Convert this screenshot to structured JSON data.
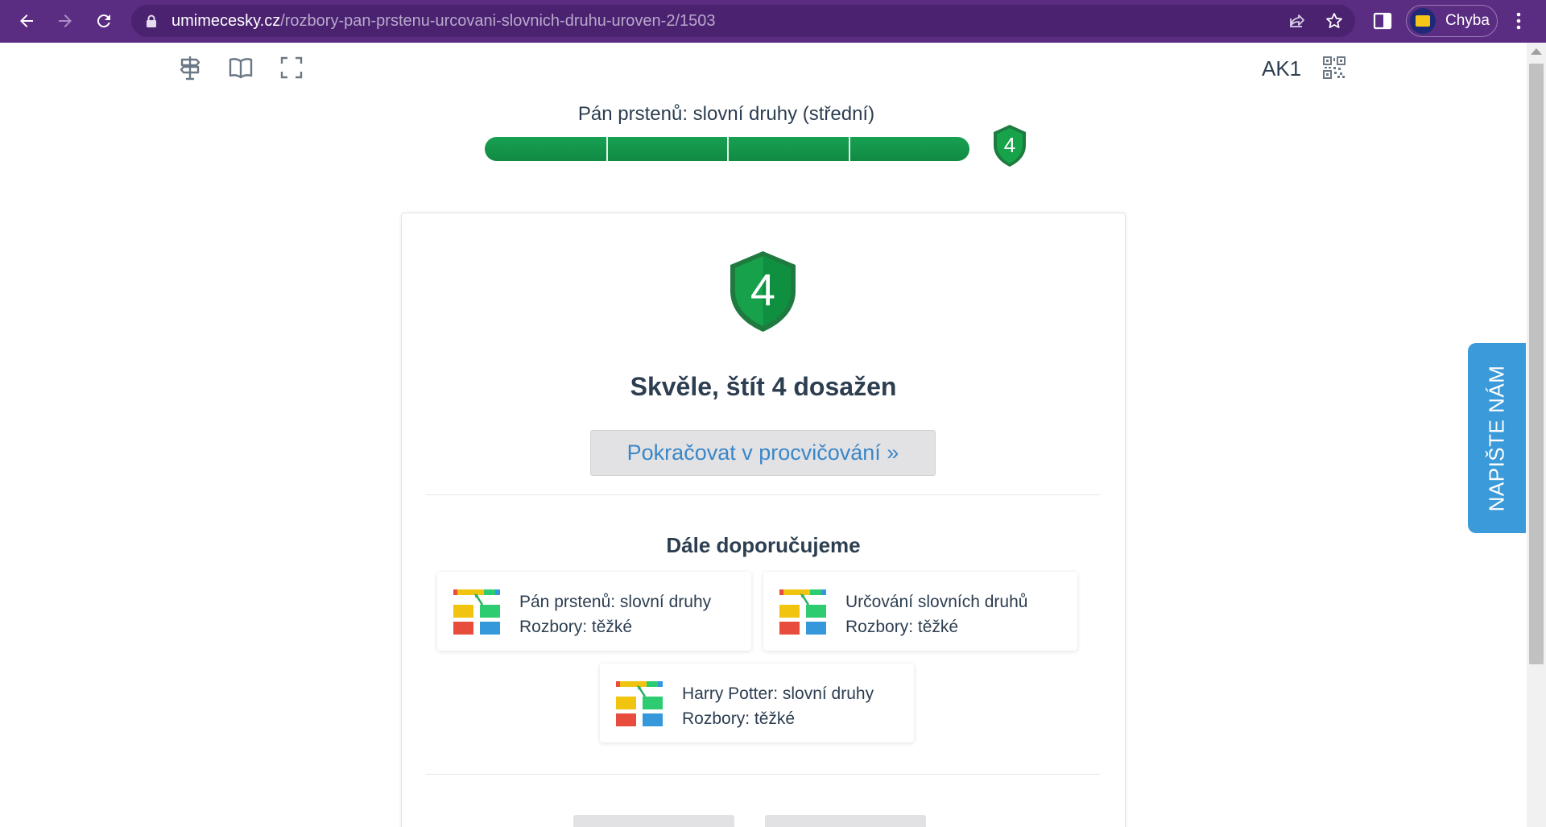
{
  "browser": {
    "url_host": "umimecesky.cz",
    "url_path": "/rozbory-pan-prstenu-urcovani-slovnich-druhu-uroven-2/1503",
    "profile_name": "Chyba"
  },
  "toolbar": {
    "user_code": "AK1"
  },
  "progress": {
    "title": "Pán prstenů: slovní druhy (střední)",
    "fraction": 1.0,
    "segments": 4,
    "shield_level": "4"
  },
  "result": {
    "shield_level": "4",
    "message": "Skvěle, štít 4 dosažen",
    "continue_label": "Pokračovat v procvičování  »"
  },
  "recommendations": {
    "title": "Dále doporučujeme",
    "items": [
      {
        "line1": "Pán prstenů: slovní druhy",
        "line2": "Rozbory: těžké"
      },
      {
        "line1": "Určování slovních druhů",
        "line2": "Rozbory: těžké"
      },
      {
        "line1": "Harry Potter: slovní druhy",
        "line2": "Rozbory: těžké"
      }
    ]
  },
  "feedback": {
    "label": "NAPIŠTE NÁM"
  },
  "colors": {
    "chrome": "#5b2d82",
    "progress_green": "#16964e",
    "shield_green": "#0f8f45",
    "link_blue": "#3a87c8",
    "feedback_blue": "#3b9ad9"
  }
}
